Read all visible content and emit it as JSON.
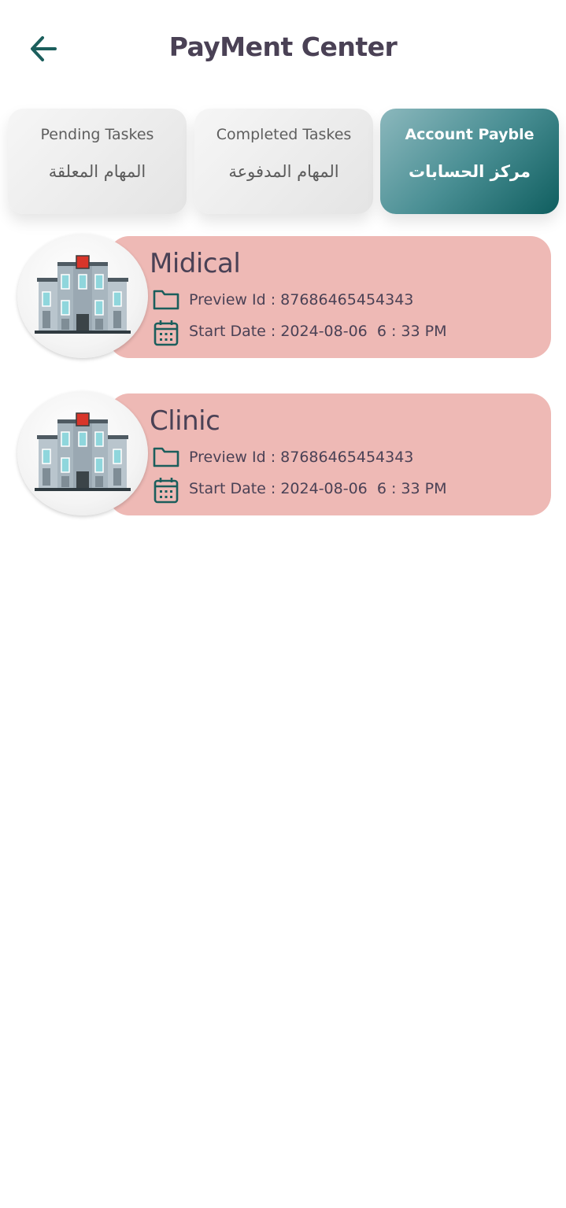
{
  "header": {
    "title": "PayMent Center"
  },
  "tabs": [
    {
      "en": "Pending Taskes",
      "ar": "المهام المعلقة",
      "active": false
    },
    {
      "en": "Completed Taskes",
      "ar": "المهام المدفوعة",
      "active": false
    },
    {
      "en": "Account Payble",
      "ar": "مركز الحسابات",
      "active": true
    }
  ],
  "cards": [
    {
      "title": "Midical",
      "preview": "Preview Id : 87686465454343",
      "date": "Start Date : 2024-08-06  6 : 33 PM"
    },
    {
      "title": "Clinic",
      "preview": "Preview Id : 87686465454343",
      "date": "Start Date : 2024-08-06  6 : 33 PM"
    }
  ],
  "colors": {
    "accent": "#0f5e5f",
    "card": "#eeb9b5",
    "text": "#4a4155"
  }
}
